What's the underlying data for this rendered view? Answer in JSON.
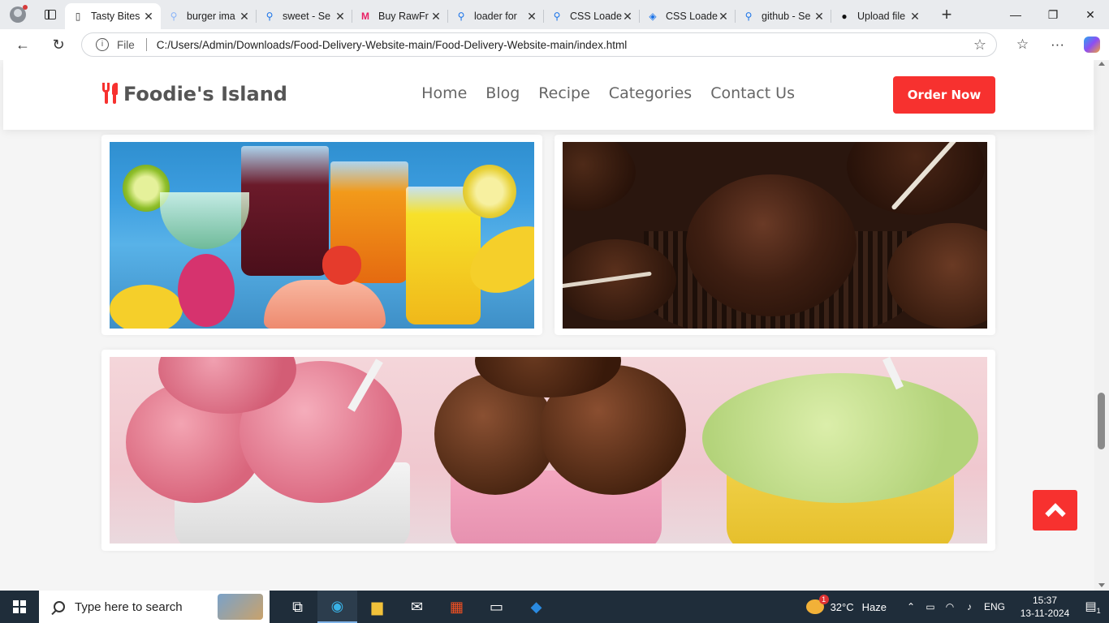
{
  "browser": {
    "tabs": [
      {
        "title": "Tasty Bites",
        "favicon": "page-icon",
        "active": true
      },
      {
        "title": "burger ima",
        "favicon": "search-icon"
      },
      {
        "title": "sweet - Se",
        "favicon": "search-icon"
      },
      {
        "title": "Buy RawFr",
        "favicon": "myntra-icon"
      },
      {
        "title": "loader for",
        "favicon": "search-icon"
      },
      {
        "title": "CSS Loade",
        "favicon": "search-icon"
      },
      {
        "title": "CSS Loade",
        "favicon": "stack-icon"
      },
      {
        "title": "github - Se",
        "favicon": "search-icon"
      },
      {
        "title": "Upload file",
        "favicon": "github-icon"
      }
    ],
    "address": {
      "scheme_label": "File",
      "url": "C:/Users/Admin/Downloads/Food-Delivery-Website-main/Food-Delivery-Website-main/index.html"
    }
  },
  "site": {
    "brand": "Foodie's Island",
    "menu": [
      "Home",
      "Blog",
      "Recipe",
      "Categories",
      "Contact Us"
    ],
    "cta": "Order Now",
    "gallery": [
      "drinks-image",
      "chocolates-image",
      "ice-cream-image"
    ]
  },
  "taskbar": {
    "search_placeholder": "Type here to search",
    "weather": {
      "temp": "32°C",
      "condition": "Haze",
      "badge": "1"
    },
    "lang": "ENG",
    "time": "15:37",
    "date": "13-11-2024",
    "notifications": "1"
  },
  "colors": {
    "accent": "#f7312f",
    "text_muted": "#666666"
  }
}
